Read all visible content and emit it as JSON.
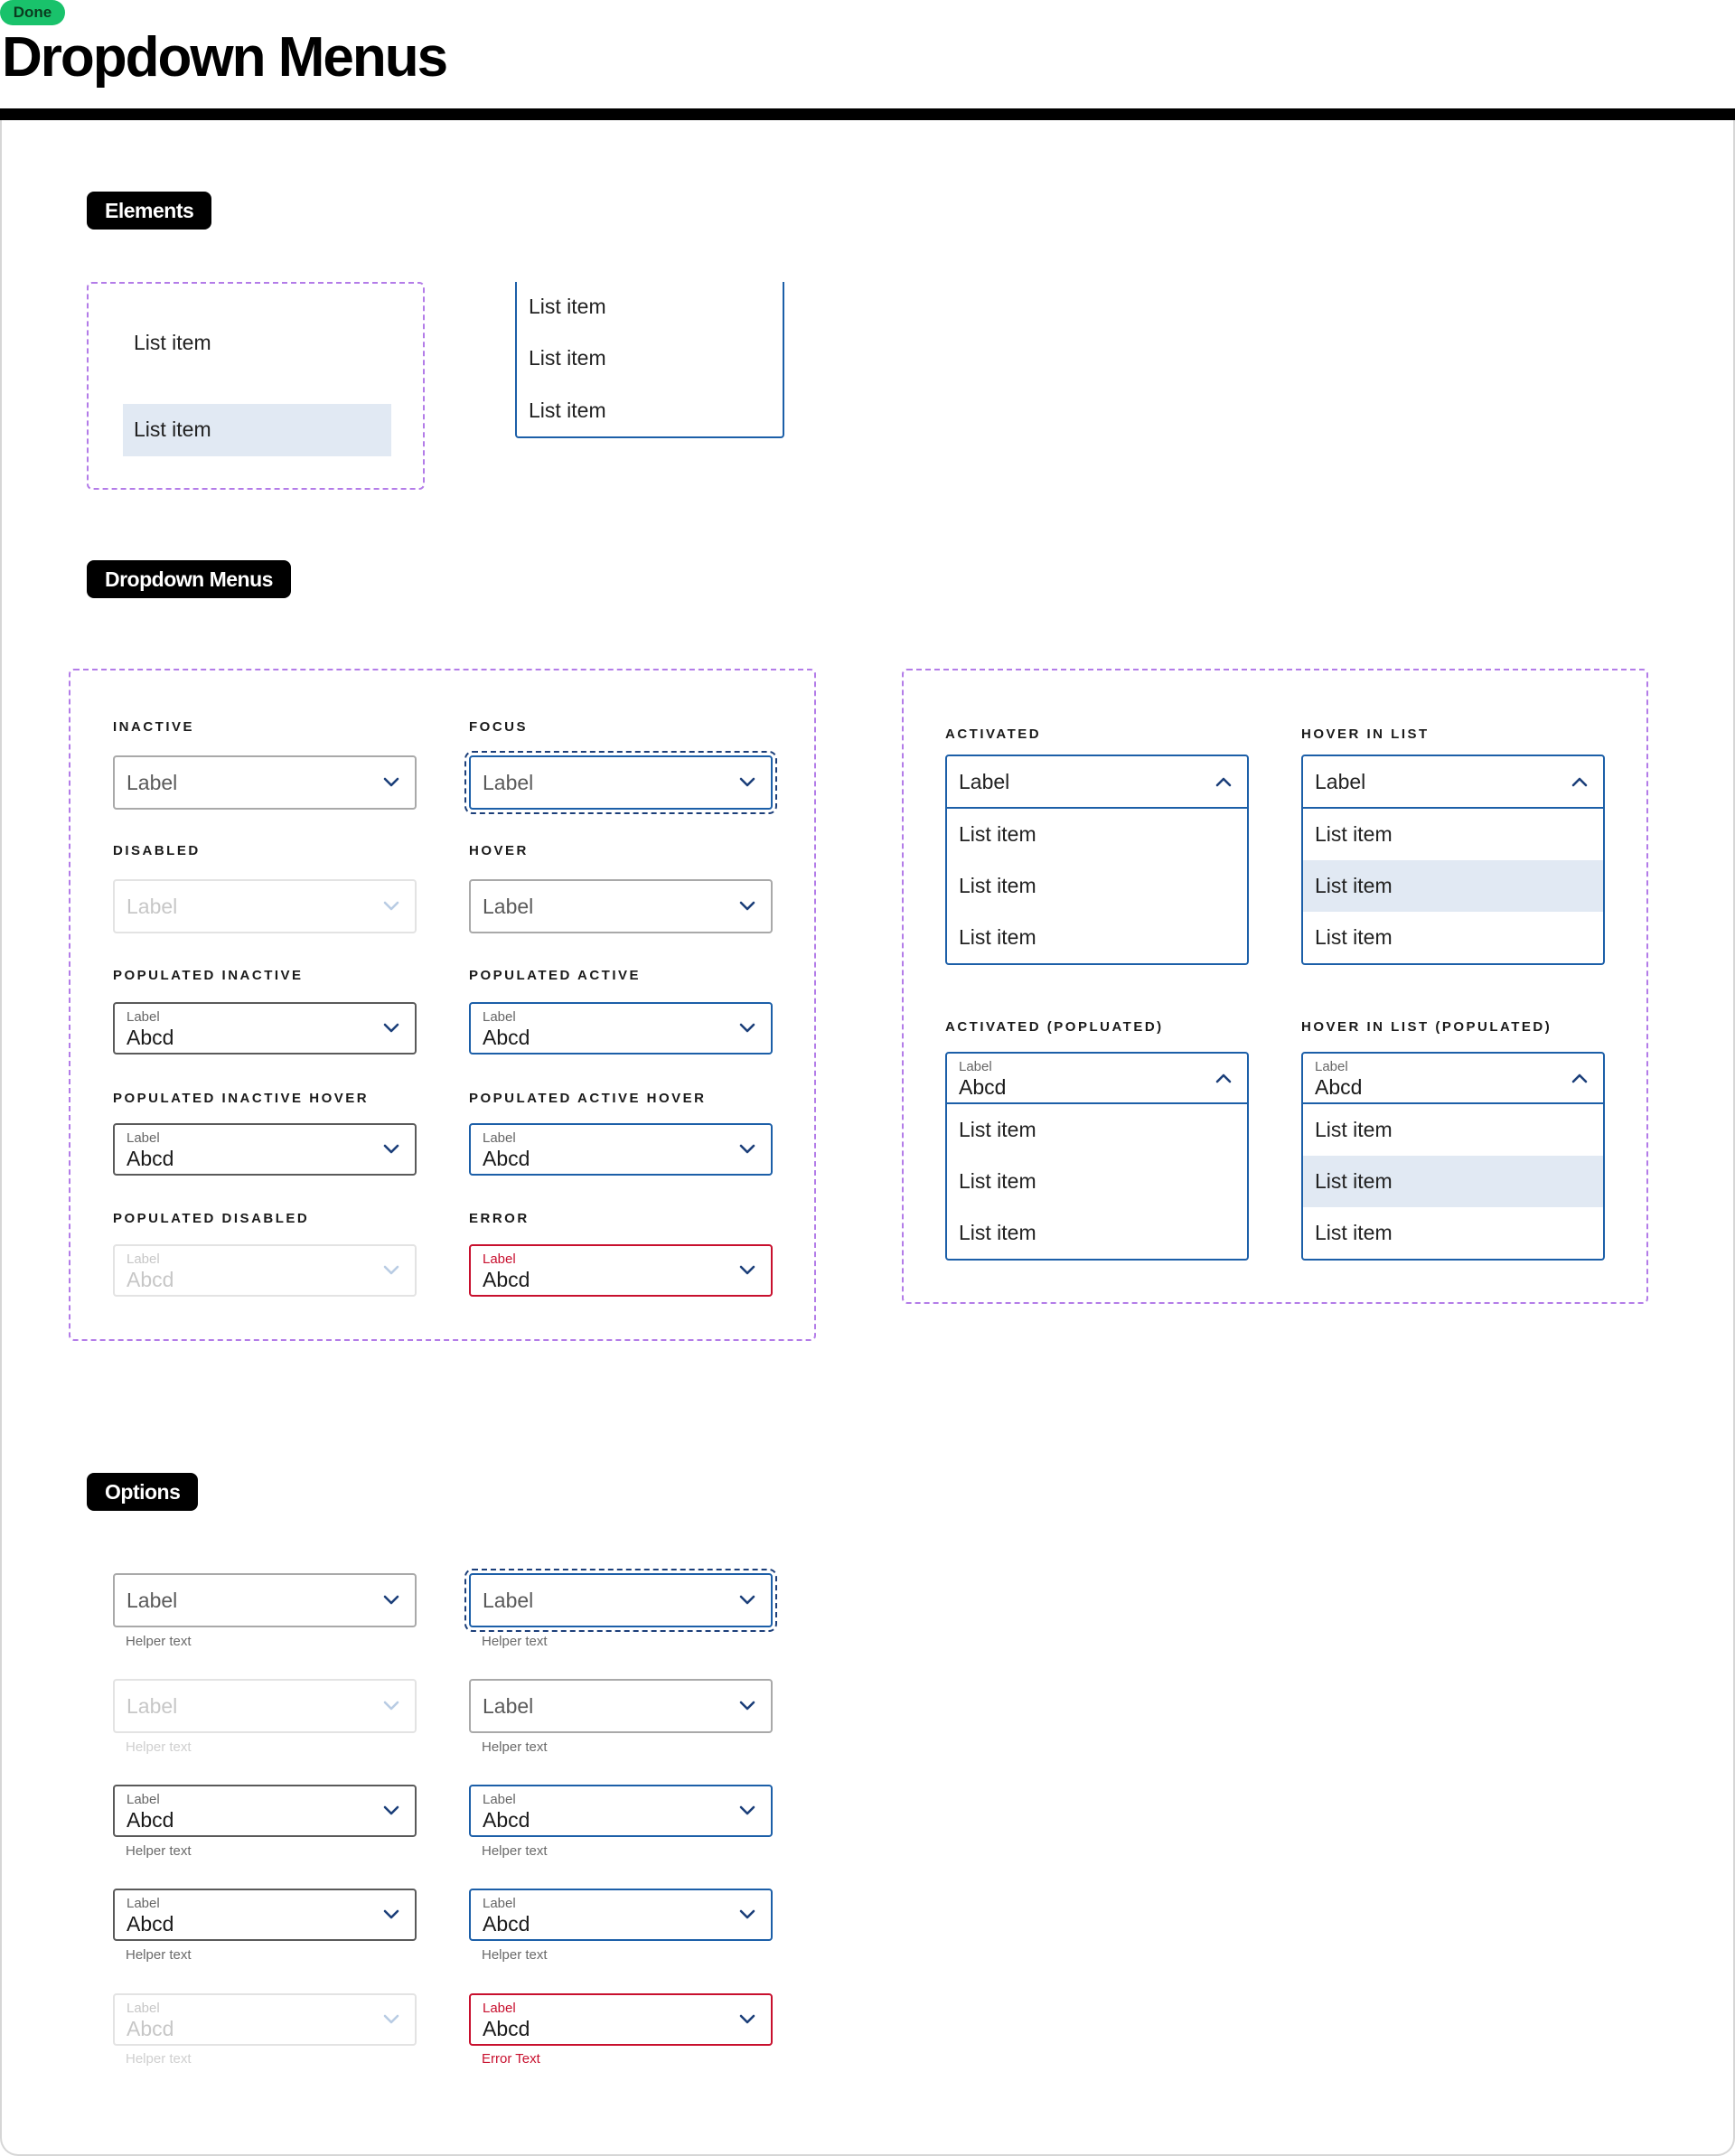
{
  "header": {
    "status": "Done",
    "title": "Dropdown Menus"
  },
  "sections": {
    "elements": "Elements",
    "dropdown_menus": "Dropdown Menus",
    "options": "Options"
  },
  "elements": {
    "item_default": "List item",
    "item_highlighted": "List item",
    "list_items": [
      "List item",
      "List item",
      "List item"
    ]
  },
  "states": {
    "inactive": "INACTIVE",
    "focus": "FOCUS",
    "disabled": "DISABLED",
    "hover": "HOVER",
    "populated_inactive": "POPULATED INACTIVE",
    "populated_active": "POPULATED ACTIVE",
    "populated_inactive_hover": "POPULATED INACTIVE HOVER",
    "populated_active_hover": "POPULATED ACTIVE HOVER",
    "populated_disabled": "POPULATED DISABLED",
    "error": "ERROR",
    "activated": "ACTIVATED",
    "hover_in_list": "HOVER IN LIST",
    "activated_populated": "ACTIVATED (POPLUATED)",
    "hover_in_list_populated": "HOVER IN LIST (POPULATED)"
  },
  "field": {
    "label": "Label",
    "value": "Abcd",
    "helper": "Helper text",
    "error_text": "Error Text"
  },
  "list": {
    "items": [
      "List item",
      "List item",
      "List item"
    ],
    "hovered_index": 1
  },
  "colors": {
    "done": "#19c26b",
    "accent_blue": "#1c5fa8",
    "error_red": "#c8102e",
    "hover_bg": "#e1e9f3",
    "dashed_purple": "#b37ce8"
  },
  "icons": {
    "chevron_closed": "chevron-down-icon",
    "chevron_open": "chevron-up-icon"
  }
}
